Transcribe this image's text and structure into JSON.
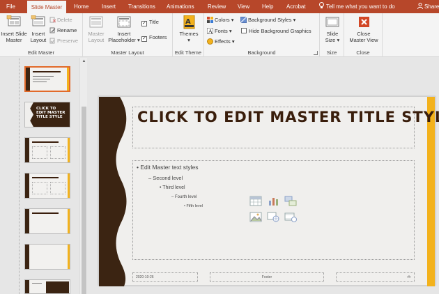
{
  "tabs": [
    {
      "label": "File"
    },
    {
      "label": "Slide Master"
    },
    {
      "label": "Home"
    },
    {
      "label": "Insert"
    },
    {
      "label": "Transitions"
    },
    {
      "label": "Animations"
    },
    {
      "label": "Review"
    },
    {
      "label": "View"
    },
    {
      "label": "Help"
    },
    {
      "label": "Acrobat"
    }
  ],
  "tell_me": "Tell me what you want to do",
  "share": "Share",
  "ribbon": {
    "edit_master": {
      "label": "Edit Master",
      "insert_slide_master": "Insert Slide Master",
      "insert_slide_master_l1": "Insert Slide",
      "insert_slide_master_l2": "Master",
      "insert_layout_l1": "Insert",
      "insert_layout_l2": "Layout",
      "delete": "Delete",
      "rename": "Rename",
      "preserve": "Preserve"
    },
    "master_layout": {
      "label": "Master Layout",
      "master_layout_l1": "Master",
      "master_layout_l2": "Layout",
      "insert_placeholder_l1": "Insert",
      "insert_placeholder_l2": "Placeholder",
      "title": "Title",
      "footers": "Footers"
    },
    "edit_theme": {
      "label": "Edit Theme",
      "themes": "Themes"
    },
    "background": {
      "label": "Background",
      "colors": "Colors",
      "fonts": "Fonts",
      "effects": "Effects",
      "background_styles": "Background Styles",
      "hide_background_graphics": "Hide Background Graphics"
    },
    "size": {
      "label": "Size",
      "slide_size_l1": "Slide",
      "slide_size_l2": "Size"
    },
    "close": {
      "label": "Close",
      "close_master_view_l1": "Close",
      "close_master_view_l2": "Master View"
    }
  },
  "slide": {
    "title": "CLICK TO EDIT MASTER TITLE STYLE",
    "levels": [
      "Edit Master text styles",
      "Second level",
      "Third level",
      "Fourth level",
      "Fifth level"
    ],
    "date": "2020-10-26",
    "footer": "Footer",
    "page_num": "‹#›"
  },
  "thumb_titles": {
    "second": "CLICK TO EDIT MASTER TITLE STYLE"
  },
  "colors": {
    "accent": "#b7472a",
    "title": "#3a1e0c",
    "wave": "#3b2412",
    "stripe": "#f3b21c"
  }
}
